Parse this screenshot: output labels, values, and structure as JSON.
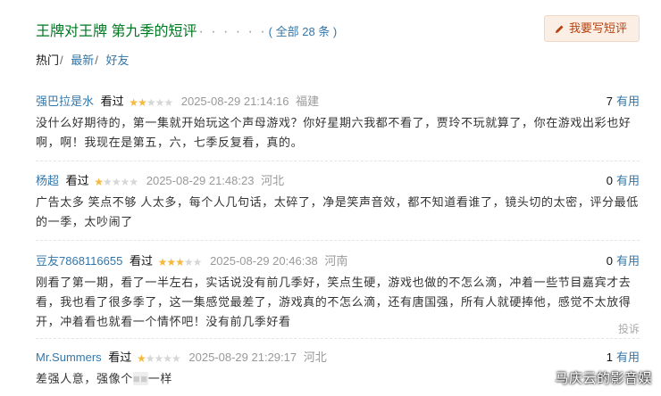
{
  "header": {
    "title": "王牌对王牌 第九季的短评",
    "dots": "· · · · · ·",
    "count_text": "( 全部 28 条 )",
    "write_button": "我要写短评"
  },
  "tabs": [
    {
      "label": "热门",
      "active": true
    },
    {
      "label": "最新",
      "active": false
    },
    {
      "label": "好友",
      "active": false
    }
  ],
  "tab_separator": "/",
  "comments": [
    {
      "user": "强巴拉是水",
      "status": "看过",
      "rating": 2,
      "time": "2025-08-29 21:14:16",
      "location": "福建",
      "useful_count": "7",
      "useful_label": "有用",
      "text": "没什么好期待的，第一集就开始玩这个声母游戏？你好星期六我都不看了，贾玲不玩就算了，你在游戏出彩也好啊，啊！我现在是第五，六，七季反复看，真的。"
    },
    {
      "user": "杨超",
      "status": "看过",
      "rating": 1,
      "time": "2025-08-29 21:48:23",
      "location": "河北",
      "useful_count": "0",
      "useful_label": "有用",
      "text": "广告太多 笑点不够 人太多，每个人几句话，太碎了，净是笑声音效，都不知道看谁了，镜头切的太密，评分最低的一季，太吵闹了"
    },
    {
      "user": "豆友7868116655",
      "status": "看过",
      "rating": 3,
      "time": "2025-08-29 20:46:38",
      "location": "河南",
      "useful_count": "0",
      "useful_label": "有用",
      "text": "刚看了第一期，看了一半左右，实话说没有前几季好，笑点生硬，游戏也做的不怎么滴，冲着一些节目嘉宾才去看，我也看了很多季了，这一集感觉最差了，游戏真的不怎么滴，还有唐国强，所有人就硬捧他，感觉不太放得开，冲着看也就看一个情怀吧！没有前几季好看",
      "report_label": "投诉"
    },
    {
      "user": "Mr.Summers",
      "status": "看过",
      "rating": 1,
      "time": "2025-08-29 21:29:17",
      "location": "河北",
      "useful_count": "1",
      "useful_label": "有用",
      "text_before": "差强人意，强像个",
      "text_blurred": "■■",
      "text_after": "一样"
    }
  ],
  "watermark": "马庆云的影音娱",
  "colors": {
    "title_green": "#007722",
    "link_blue": "#3377aa",
    "star": "#f4b93d",
    "button_bg": "#fbeee4",
    "button_text": "#b7420f"
  },
  "icons": {
    "write_button": "pencil-icon",
    "rating": "star-icon"
  }
}
